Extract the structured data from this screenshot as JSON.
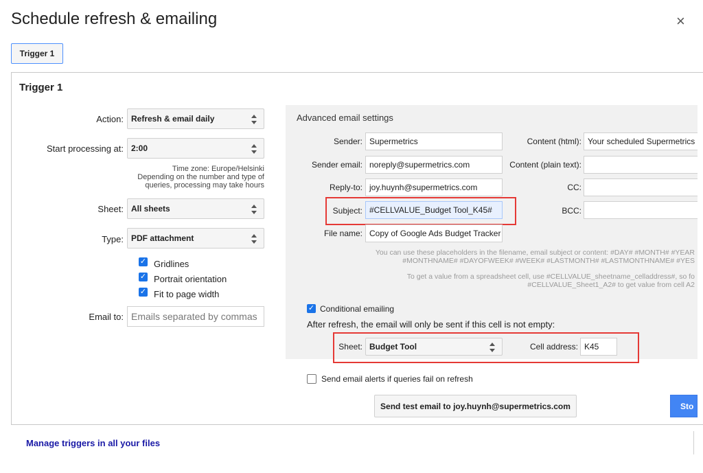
{
  "dialog": {
    "title": "Schedule refresh & emailing",
    "close_icon": "×",
    "tabs": [
      {
        "label": "Trigger 1"
      }
    ]
  },
  "trigger": {
    "title": "Trigger 1",
    "action": {
      "label": "Action:",
      "value": "Refresh & email daily"
    },
    "start": {
      "label": "Start processing at:",
      "value": "2:00"
    },
    "timezone_note": [
      "Time zone: Europe/Helsinki",
      "Depending on the number and type of",
      "queries, processing may take hours"
    ],
    "sheet": {
      "label": "Sheet:",
      "value": "All sheets"
    },
    "type": {
      "label": "Type:",
      "value": "PDF attachment"
    },
    "options": [
      {
        "label": "Gridlines",
        "checked": true
      },
      {
        "label": "Portrait orientation",
        "checked": true
      },
      {
        "label": "Fit to page width",
        "checked": true
      }
    ],
    "email_to": {
      "label": "Email to:",
      "placeholder": "Emails separated by commas"
    }
  },
  "advanced": {
    "title": "Advanced email settings",
    "sender": {
      "label": "Sender:",
      "value": "Supermetrics"
    },
    "sender_email": {
      "label": "Sender email:",
      "value": "noreply@supermetrics.com"
    },
    "reply_to": {
      "label": "Reply-to:",
      "value": "joy.huynh@supermetrics.com"
    },
    "subject": {
      "label": "Subject:",
      "value": "#CELLVALUE_Budget Tool_K45#"
    },
    "file_name": {
      "label": "File name:",
      "value": "Copy of Google Ads Budget Tracker"
    },
    "content_html": {
      "label": "Content (html):",
      "value": "Your scheduled Supermetrics"
    },
    "content_plain": {
      "label": "Content (plain text):",
      "value": ""
    },
    "cc": {
      "label": "CC:",
      "value": ""
    },
    "bcc": {
      "label": "BCC:",
      "value": ""
    },
    "help1": [
      "You can use these placeholders in the filename, email subject or content: #DAY# #MONTH# #YEAR",
      "#MONTHNAME# #DAYOFWEEK# #WEEK# #LASTMONTH# #LASTMONTHNAME# #YES"
    ],
    "help2": [
      "To get a value from a spreadsheet cell, use #CELLVALUE_sheetname_celladdress#, so fo",
      "#CELLVALUE_Sheet1_A2# to get value from cell A2"
    ],
    "conditional": {
      "label": "Conditional emailing",
      "checked": true,
      "description": "After refresh, the email will only be sent if this cell is not empty:",
      "sheet_label": "Sheet:",
      "sheet_value": "Budget Tool",
      "cell_label": "Cell address:",
      "cell_value": "K45"
    }
  },
  "alerts": {
    "label": "Send email alerts if queries fail on refresh",
    "checked": false
  },
  "buttons": {
    "send_test": "Send test email to joy.huynh@supermetrics.com",
    "store": "Sto"
  },
  "footer": {
    "manage_link": "Manage triggers in all your files"
  },
  "colors": {
    "accent": "#4285f4",
    "highlight": "#e53935",
    "link": "#1a1aa6"
  }
}
